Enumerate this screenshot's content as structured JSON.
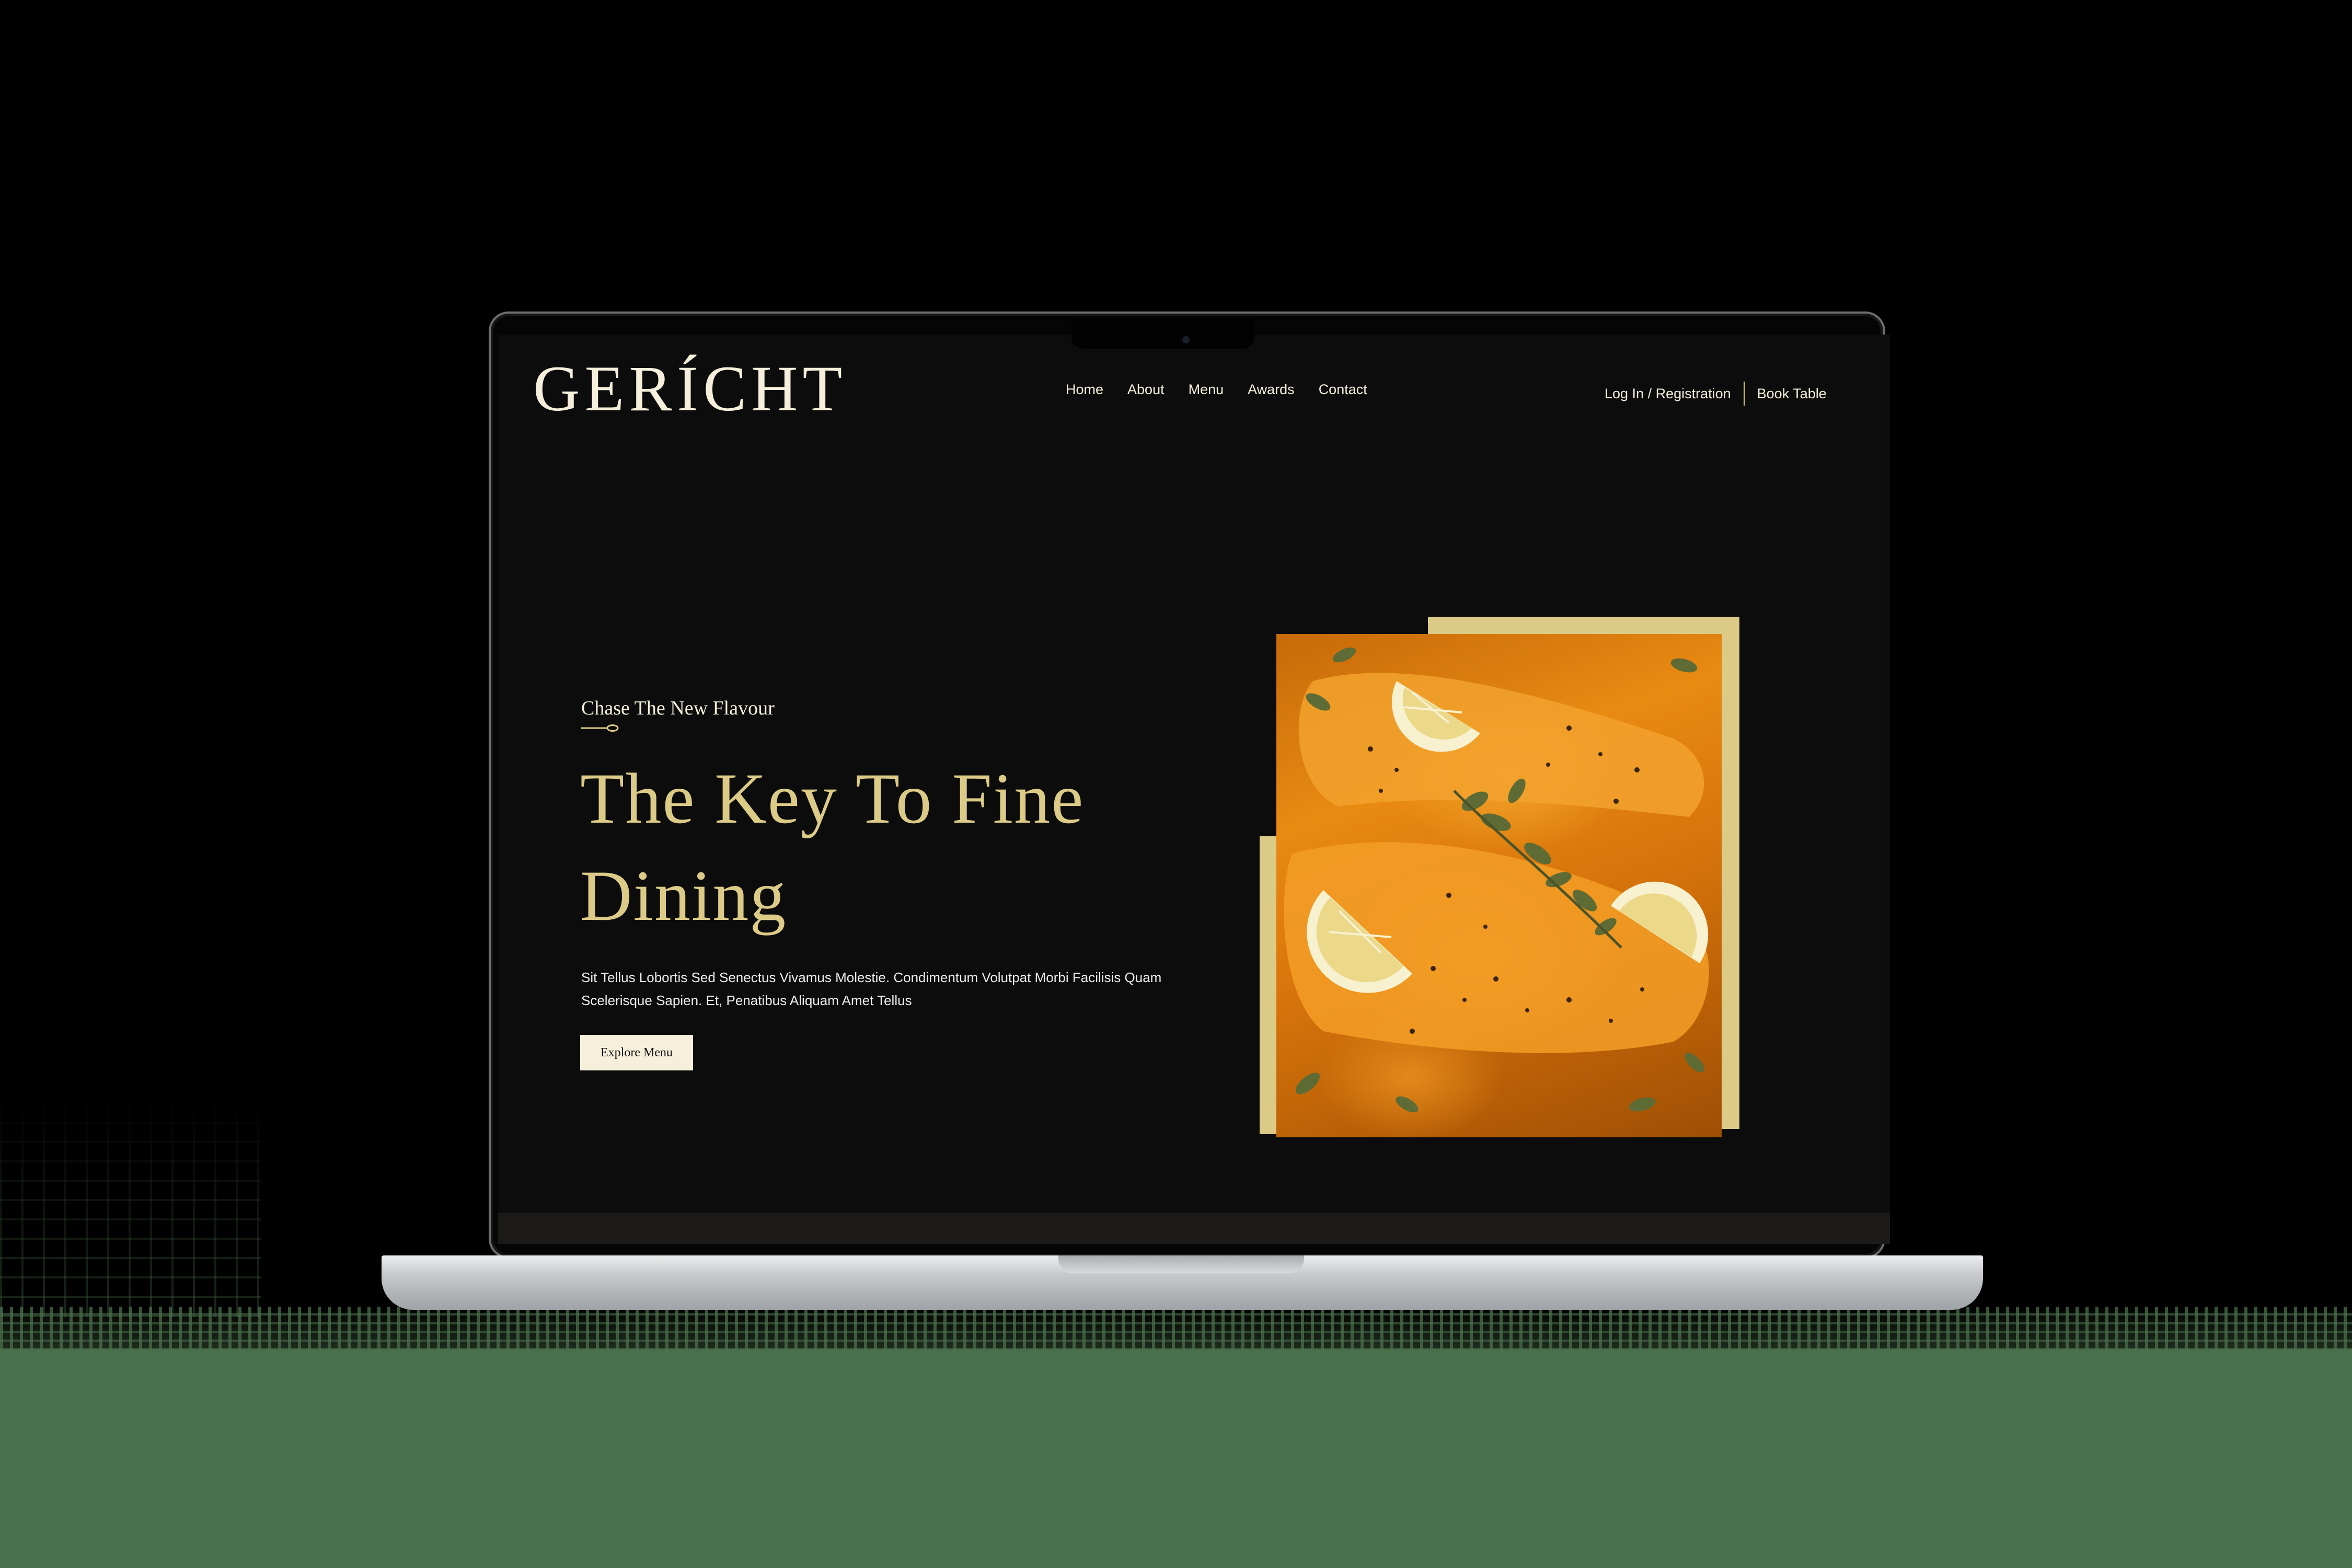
{
  "site": {
    "logo": "GERÍCHT",
    "nav": [
      "Home",
      "About",
      "Menu",
      "Awards",
      "Contact"
    ],
    "login_label": "Log In / Registration",
    "book_label": "Book Table"
  },
  "hero": {
    "subtitle": "Chase The New Flavour",
    "title": "The Key To Fine Dining",
    "description": "Sit Tellus Lobortis Sed Senectus Vivamus Molestie. Condimentum Volutpat Morbi Facilisis Quam Scelerisque Sapien. Et, Penatibus Aliquam Amet Tellus",
    "button_label": "Explore Menu"
  },
  "icons": {
    "spoon": "spoon-icon",
    "dish": "salmon-dish-image"
  },
  "colors": {
    "background": "#0c0c0c",
    "gold": "#dcca87",
    "cream": "#f5efdb",
    "backdrop_floor": "#4a6f4b"
  }
}
